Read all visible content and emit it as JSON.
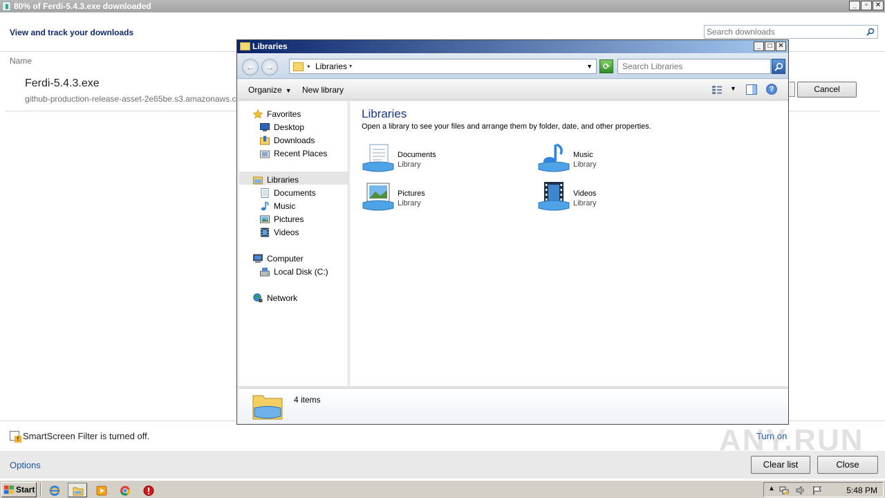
{
  "download_manager": {
    "title": "80% of Ferdi-5.4.3.exe downloaded",
    "header": "View and track your downloads",
    "search_placeholder": "Search downloads",
    "column_name": "Name",
    "item": {
      "filename": "Ferdi-5.4.3.exe",
      "source": "github-production-release-asset-2e65be.s3.amazonaws.c"
    },
    "cancel_label": "Cancel",
    "smartscreen_text": "SmartScreen Filter is turned off.",
    "turn_on_label": "Turn on",
    "options_label": "Options",
    "clear_list_label": "Clear list",
    "close_label": "Close"
  },
  "explorer": {
    "title": "Libraries",
    "address_crumb": "Libraries",
    "search_placeholder": "Search Libraries",
    "toolbar": {
      "organize": "Organize",
      "new_library": "New library"
    },
    "nav": {
      "favorites": "Favorites",
      "desktop": "Desktop",
      "downloads": "Downloads",
      "recent_places": "Recent Places",
      "libraries": "Libraries",
      "documents": "Documents",
      "music": "Music",
      "pictures": "Pictures",
      "videos": "Videos",
      "computer": "Computer",
      "local_disk": "Local Disk (C:)",
      "network": "Network"
    },
    "content": {
      "heading": "Libraries",
      "description": "Open a library to see your files and arrange them by folder, date, and other properties.",
      "libraries": [
        {
          "name": "Documents",
          "type": "Library",
          "icon": "documents-library-icon"
        },
        {
          "name": "Music",
          "type": "Library",
          "icon": "music-library-icon"
        },
        {
          "name": "Pictures",
          "type": "Library",
          "icon": "pictures-library-icon"
        },
        {
          "name": "Videos",
          "type": "Library",
          "icon": "videos-library-icon"
        }
      ]
    },
    "details": {
      "count": "4 items"
    }
  },
  "taskbar": {
    "start_label": "Start",
    "clock": "5:48 PM"
  },
  "watermark": "ANY.RUN",
  "colors": {
    "explorer_title_start": "#0a246a",
    "explorer_title_end": "#a6caf0",
    "link": "#1b55a7",
    "heading_blue": "#1e3287",
    "nav_selected": "#e5e5e5"
  }
}
